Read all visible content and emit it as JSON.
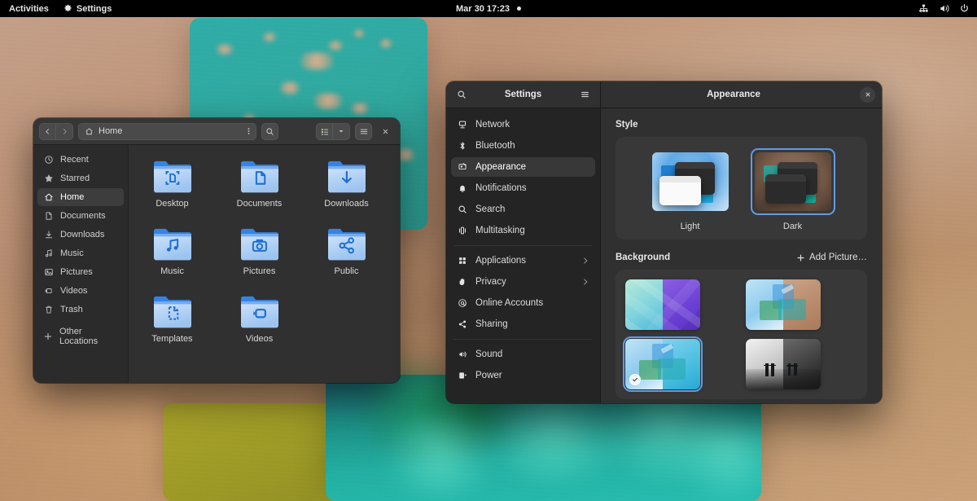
{
  "topbar": {
    "activities": "Activities",
    "app_name": "Settings",
    "app_icon": "gear-icon",
    "clock": "Mar 30  17:23",
    "notification_dot": true,
    "tray": [
      {
        "name": "network-wired-icon"
      },
      {
        "name": "volume-icon"
      },
      {
        "name": "power-icon"
      }
    ]
  },
  "files_window": {
    "header": {
      "back_icon": "chevron-left-icon",
      "forward_icon": "chevron-right-icon",
      "path_label": "Home",
      "path_icon": "home-icon",
      "path_menu_icon": "vertical-dots-icon",
      "search_icon": "search-icon",
      "view_icon": "list-view-icon",
      "view_dropdown_icon": "chevron-down-icon",
      "menu_icon": "hamburger-icon",
      "close_icon": "close-icon"
    },
    "sidebar": [
      {
        "label": "Recent",
        "icon": "clock-icon",
        "active": false
      },
      {
        "label": "Starred",
        "icon": "star-icon",
        "active": false
      },
      {
        "label": "Home",
        "icon": "home-icon",
        "active": true
      },
      {
        "label": "Documents",
        "icon": "document-icon",
        "active": false
      },
      {
        "label": "Downloads",
        "icon": "download-icon",
        "active": false
      },
      {
        "label": "Music",
        "icon": "music-icon",
        "active": false
      },
      {
        "label": "Pictures",
        "icon": "picture-icon",
        "active": false
      },
      {
        "label": "Videos",
        "icon": "video-icon",
        "active": false
      },
      {
        "label": "Trash",
        "icon": "trash-icon",
        "active": false
      },
      {
        "label": "Other Locations",
        "icon": "plus-icon",
        "active": false
      }
    ],
    "folders": [
      {
        "name": "Desktop",
        "emblem": "desktop-emblem"
      },
      {
        "name": "Documents",
        "emblem": "document-emblem"
      },
      {
        "name": "Downloads",
        "emblem": "download-emblem"
      },
      {
        "name": "Music",
        "emblem": "music-emblem"
      },
      {
        "name": "Pictures",
        "emblem": "camera-emblem"
      },
      {
        "name": "Public",
        "emblem": "share-emblem"
      },
      {
        "name": "Templates",
        "emblem": "template-emblem"
      },
      {
        "name": "Videos",
        "emblem": "camcorder-emblem"
      }
    ]
  },
  "settings_window": {
    "header": {
      "search_icon": "search-icon",
      "sidebar_title": "Settings",
      "menu_icon": "hamburger-icon",
      "page_title": "Appearance",
      "close_icon": "close-icon"
    },
    "sidebar": [
      {
        "label": "Network",
        "icon": "network-icon",
        "active": false,
        "chevron": false
      },
      {
        "label": "Bluetooth",
        "icon": "bluetooth-icon",
        "active": false,
        "chevron": false
      },
      {
        "label": "Appearance",
        "icon": "appearance-icon",
        "active": true,
        "chevron": false
      },
      {
        "label": "Notifications",
        "icon": "bell-icon",
        "active": false,
        "chevron": false
      },
      {
        "label": "Search",
        "icon": "search-icon",
        "active": false,
        "chevron": false
      },
      {
        "label": "Multitasking",
        "icon": "multitasking-icon",
        "active": false,
        "chevron": false
      },
      {
        "separator": true
      },
      {
        "label": "Applications",
        "icon": "grid-icon",
        "active": false,
        "chevron": true
      },
      {
        "label": "Privacy",
        "icon": "hand-icon",
        "active": false,
        "chevron": true
      },
      {
        "label": "Online Accounts",
        "icon": "at-icon",
        "active": false,
        "chevron": false
      },
      {
        "label": "Sharing",
        "icon": "share-icon",
        "active": false,
        "chevron": false
      },
      {
        "separator": true
      },
      {
        "label": "Sound",
        "icon": "sound-icon",
        "active": false,
        "chevron": false
      },
      {
        "label": "Power",
        "icon": "battery-icon",
        "active": false,
        "chevron": false
      }
    ],
    "style_section": {
      "title": "Style",
      "options": [
        {
          "label": "Light",
          "selected": false
        },
        {
          "label": "Dark",
          "selected": true
        }
      ]
    },
    "background_section": {
      "title": "Background",
      "add_label": "Add Picture…",
      "add_icon": "plus-icon",
      "wallpapers": [
        {
          "name": "geometric-teal-purple",
          "selected": false
        },
        {
          "name": "shapes-blue-tan",
          "selected": false
        },
        {
          "name": "shapes-blue-cyan",
          "selected": true
        },
        {
          "name": "pier-monochrome",
          "selected": false
        }
      ]
    }
  },
  "colors": {
    "accent": "#5e9ce8",
    "folder_blue": "#3584e4",
    "topbar_bg": "#000000",
    "window_bg": "#303030",
    "header_bg": "#363636",
    "sidebar_bg": "#242424"
  }
}
